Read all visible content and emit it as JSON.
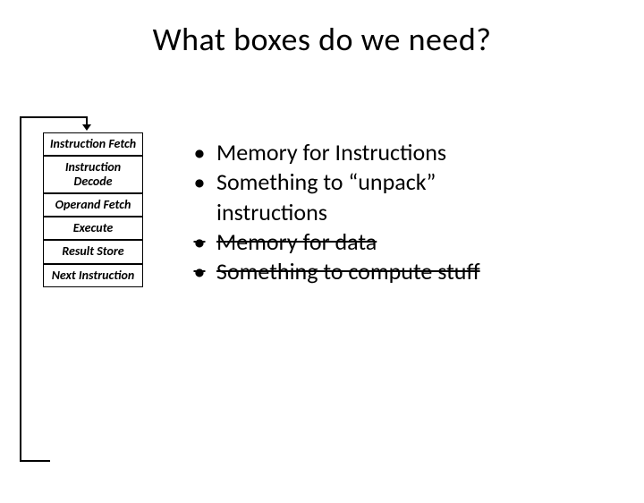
{
  "title": "What boxes do we need?",
  "flow": {
    "stages": [
      "Instruction Fetch",
      "Instruction Decode",
      "Operand Fetch",
      "Execute",
      "Result Store",
      "Next Instruction"
    ]
  },
  "bullets": [
    {
      "text": "Memory for Instructions",
      "struck": false
    },
    {
      "text": "Something to “unpack” instructions",
      "struck": false,
      "wrap": [
        "Something to “unpack”",
        "instructions"
      ]
    },
    {
      "text": "Memory for data",
      "struck": true
    },
    {
      "text": "Something to compute stuff",
      "struck": true
    }
  ]
}
